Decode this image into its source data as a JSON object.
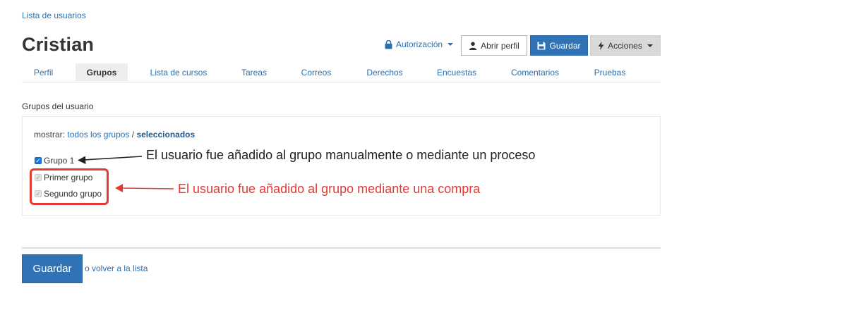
{
  "breadcrumb": {
    "label": "Lista de usuarios"
  },
  "page": {
    "title": "Cristian"
  },
  "header_actions": {
    "authorization": "Autorización",
    "open_profile": "Abrir perfil",
    "save": "Guardar",
    "actions": "Acciones"
  },
  "tabs": [
    {
      "label": "Perfil"
    },
    {
      "label": "Grupos",
      "active": true
    },
    {
      "label": "Lista de cursos"
    },
    {
      "label": "Tareas"
    },
    {
      "label": "Correos"
    },
    {
      "label": "Derechos"
    },
    {
      "label": "Encuestas"
    },
    {
      "label": "Comentarios"
    },
    {
      "label": "Pruebas"
    }
  ],
  "groups": {
    "section_label": "Grupos del usuario",
    "filter_prefix": "mostrar:",
    "filter_all": "todos los grupos",
    "filter_separator": "/",
    "filter_selected": "seleccionados",
    "items": [
      {
        "label": "Grupo 1",
        "checked": true,
        "disabled": false
      },
      {
        "label": "Primer grupo",
        "checked": true,
        "disabled": true
      },
      {
        "label": "Segundo grupo",
        "checked": true,
        "disabled": true
      }
    ]
  },
  "annotations": {
    "manual": "El usuario fue añadido al grupo manualmente o mediante un proceso",
    "purchase": "El usuario fue añadido al grupo mediante una compra",
    "colors": {
      "black": "#222222",
      "red": "#e53935"
    }
  },
  "footer": {
    "save": "Guardar",
    "back_link": "o volver a la lista"
  },
  "colors": {
    "primary": "#2f73b6",
    "link": "#2a6fb0",
    "actions_bg": "#d9d9d9"
  }
}
